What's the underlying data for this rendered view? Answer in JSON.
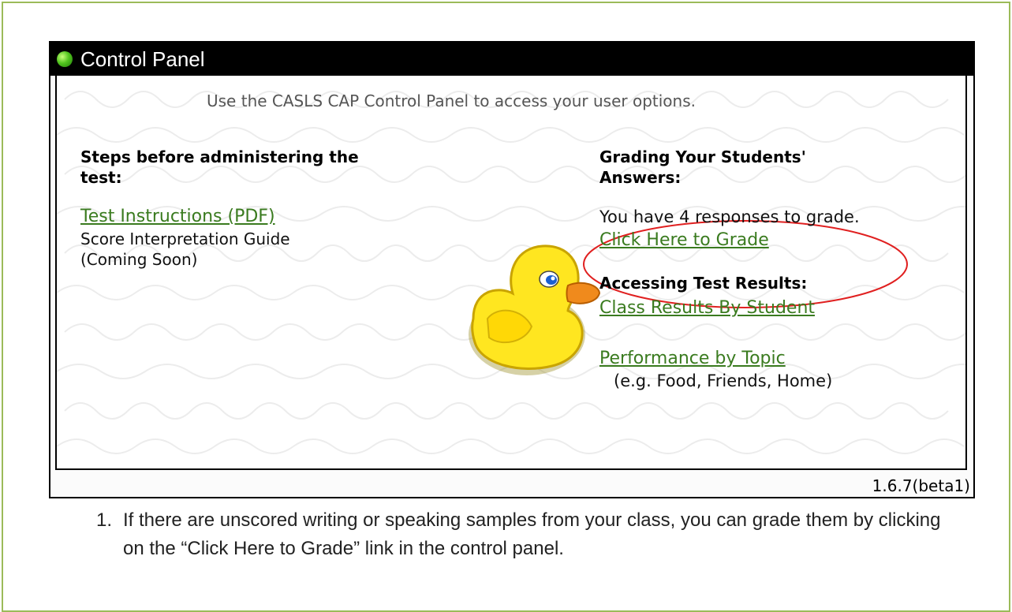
{
  "panel": {
    "title": "Control Panel",
    "intro": "Use the CASLS CAP Control Panel to access your user options.",
    "version": "1.6.7(beta1)"
  },
  "left": {
    "heading_line1": "Steps before administering the",
    "heading_line2": "test:",
    "instructions_link": "Test Instructions (PDF)",
    "guide_line1": "Score Interpretation Guide",
    "guide_line2": "(Coming Soon)"
  },
  "right": {
    "grading_heading_line1": "Grading Your Students'",
    "grading_heading_line2": "Answers:",
    "responses_text": "You have 4 responses to grade.",
    "grade_link": "Click Here to Grade",
    "results_heading": "Accessing Test Results:",
    "class_results_link": "Class Results By Student",
    "performance_link": "Performance by Topic",
    "performance_note": "(e.g. Food, Friends, Home)"
  },
  "footnote": {
    "number": "1.",
    "text": "If there are unscored writing or speaking samples from your class, you can grade them by clicking on the “Click Here to Grade” link in the control panel."
  },
  "colors": {
    "frame_border": "#9bbb59",
    "link_green": "#3a7b1f",
    "highlight_ellipse": "#e02020",
    "duck_yellow": "#ffe620",
    "beak_orange": "#f08a1c"
  },
  "icons": [
    "green-dot-icon",
    "rubber-duck-icon"
  ]
}
